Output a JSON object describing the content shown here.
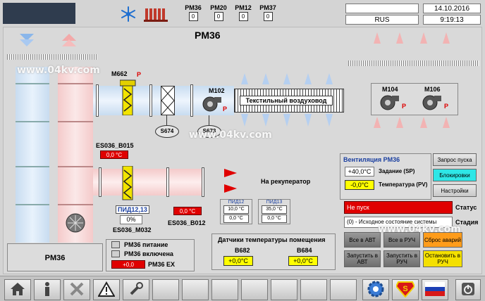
{
  "header": {
    "tiles": [
      {
        "label": "PM36",
        "value": "0"
      },
      {
        "label": "PM20",
        "value": "0"
      },
      {
        "label": "PM12",
        "value": "0"
      },
      {
        "label": "PM37",
        "value": "0"
      }
    ],
    "language": "RUS",
    "date": "14.10.2016",
    "time": "9:19:13"
  },
  "page_title": "PM36",
  "watermark": "www.04kv.com",
  "equipment": {
    "m662": "M662",
    "p_marker": "P",
    "m102": "M102",
    "duct_label": "Текстильный воздуховод",
    "s674": "S674",
    "s673": "S673",
    "m104": "M104",
    "m106": "M106",
    "es036_b015": "ES036_B015",
    "b015_value": "0,0 °C",
    "pid_label": "ПИД12,13",
    "pid_value": "0%",
    "es036_m032": "ES036_M032",
    "es036_b012": "ES036_B012",
    "b012_value": "0,0 °C",
    "recuperator": "На рекуператор"
  },
  "pid12": {
    "title": "ПИД12",
    "v1": "10,0 °C",
    "v2": "0,0 °C"
  },
  "pid13": {
    "title": "ПИД13",
    "v1": "35,0 °C",
    "v2": "0,0 °C"
  },
  "room_sensors": {
    "title": "Датчики температуры помещения",
    "b682": {
      "label": "B682",
      "value": "+0,0°C"
    },
    "b684": {
      "label": "B684",
      "value": "+0,0°C"
    }
  },
  "status_legend": {
    "box_label": "PM36",
    "power": "PM36 питание",
    "enabled": "PM36 включена",
    "ex_value": "+0,0",
    "ex_label": "PM36 EX"
  },
  "ventilation": {
    "title": "Вентиляция PM36",
    "setpoint_value": "+40,0°C",
    "setpoint_label": "Задание (SP)",
    "pv_value": "-0,0°C",
    "pv_label": "Температура (PV)",
    "status_text": "Не пуск",
    "status_label": "Статус",
    "stage_text": "(0) - Исходное состояние системы",
    "stage_label": "Стадия",
    "buttons": {
      "start_request": "Запрос пуска",
      "locks": "Блокировки",
      "settings": "Настройки",
      "all_auto": "Все в АВТ",
      "all_manual": "Все в РУЧ",
      "reset_alarms": "Сброс аварий",
      "start_auto": "Запустить в АВТ",
      "start_manual": "Запустить в РУЧ",
      "stop_manual": "Остановить в РУЧ"
    }
  },
  "footer": {
    "icons": [
      "home-icon",
      "person-icon",
      "close-icon",
      "warning-icon",
      "wrench-icon",
      "gear-icon",
      "superman-icon",
      "russia-flag-icon",
      "power-icon"
    ]
  },
  "colors": {
    "alarm_red": "#e00000",
    "value_yellow": "#ffff00",
    "accent_cyan": "#2ee6e6",
    "reset_orange": "#ff9c1a"
  }
}
